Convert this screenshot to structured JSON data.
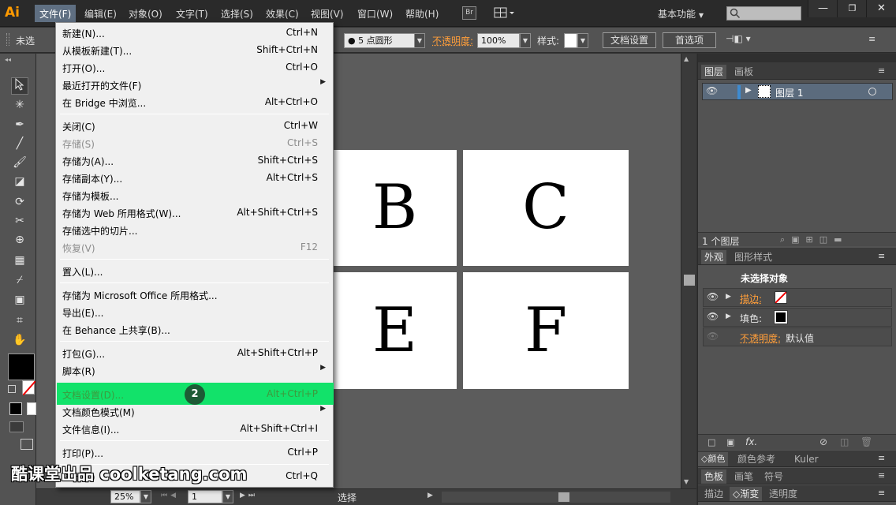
{
  "app": {
    "logo": "Ai"
  },
  "menubar": {
    "items": [
      "文件(F)",
      "编辑(E)",
      "对象(O)",
      "文字(T)",
      "选择(S)",
      "效果(C)",
      "视图(V)",
      "窗口(W)",
      "帮助(H)"
    ],
    "bridge_label": "Br",
    "workspace": "基本功能",
    "search_placeholder": ""
  },
  "control_bar": {
    "selection_state": "未选",
    "stroke_profile": "5 点圆形",
    "opacity_label": "不透明度:",
    "opacity_value": "100%",
    "style_label": "样式:",
    "document_setup_button": "文档设置",
    "preferences_button": "首选项"
  },
  "file_menu": {
    "items": [
      {
        "label": "新建(N)...",
        "shortcut": "Ctrl+N"
      },
      {
        "label": "从模板新建(T)...",
        "shortcut": "Shift+Ctrl+N"
      },
      {
        "label": "打开(O)...",
        "shortcut": "Ctrl+O"
      },
      {
        "label": "最近打开的文件(F)",
        "shortcut": ""
      },
      {
        "label": "在 Bridge 中浏览...",
        "shortcut": "Alt+Ctrl+O"
      },
      {
        "label": "关闭(C)",
        "shortcut": "Ctrl+W"
      },
      {
        "label": "存储(S)",
        "shortcut": "Ctrl+S"
      },
      {
        "label": "存储为(A)...",
        "shortcut": "Shift+Ctrl+S"
      },
      {
        "label": "存储副本(Y)...",
        "shortcut": "Alt+Ctrl+S"
      },
      {
        "label": "存储为模板...",
        "shortcut": ""
      },
      {
        "label": "存储为 Web 所用格式(W)...",
        "shortcut": "Alt+Shift+Ctrl+S"
      },
      {
        "label": "存储选中的切片...",
        "shortcut": ""
      },
      {
        "label": "恢复(V)",
        "shortcut": "F12"
      },
      {
        "label": "置入(L)...",
        "shortcut": ""
      },
      {
        "label": "存储为 Microsoft Office 所用格式...",
        "shortcut": ""
      },
      {
        "label": "导出(E)...",
        "shortcut": ""
      },
      {
        "label": "在 Behance 上共享(B)...",
        "shortcut": ""
      },
      {
        "label": "打包(G)...",
        "shortcut": "Alt+Shift+Ctrl+P"
      },
      {
        "label": "脚本(R)",
        "shortcut": ""
      },
      {
        "label": "文档设置(D)...",
        "shortcut": "Alt+Ctrl+P"
      },
      {
        "label": "文档颜色模式(M)",
        "shortcut": ""
      },
      {
        "label": "文件信息(I)...",
        "shortcut": "Alt+Shift+Ctrl+I"
      },
      {
        "label": "打印(P)...",
        "shortcut": "Ctrl+P"
      },
      {
        "label": "退出(X)",
        "shortcut": "Ctrl+Q"
      }
    ],
    "step_badge": "2"
  },
  "canvas": {
    "tiles": [
      "B",
      "C",
      "E",
      "F"
    ]
  },
  "status_bar": {
    "zoom": "25%",
    "artboard": "1",
    "tool": "选择"
  },
  "layers_panel": {
    "tabs": [
      "图层",
      "画板"
    ],
    "layer_name": "图层 1",
    "footer_count": "1 个图层"
  },
  "appearance_panel": {
    "tabs": [
      "外观",
      "图形样式"
    ],
    "header": "未选择对象",
    "stroke_label": "描边:",
    "fill_label": "填色:",
    "opacity_label": "不透明度:",
    "opacity_value": "默认值",
    "fx_label": "fx."
  },
  "bottom_panels": {
    "row1": [
      "颜色",
      "颜色参考",
      "Kuler"
    ],
    "row2": [
      "色板",
      "画笔",
      "符号"
    ],
    "row3": [
      "描边",
      "渐变",
      "透明度"
    ]
  },
  "watermark": "酷课堂出品 coolketang.com",
  "colors": {
    "highlight": "#12e26a",
    "accent_orange": "#ff9e3a",
    "menu_bg": "#f0f0f0"
  }
}
